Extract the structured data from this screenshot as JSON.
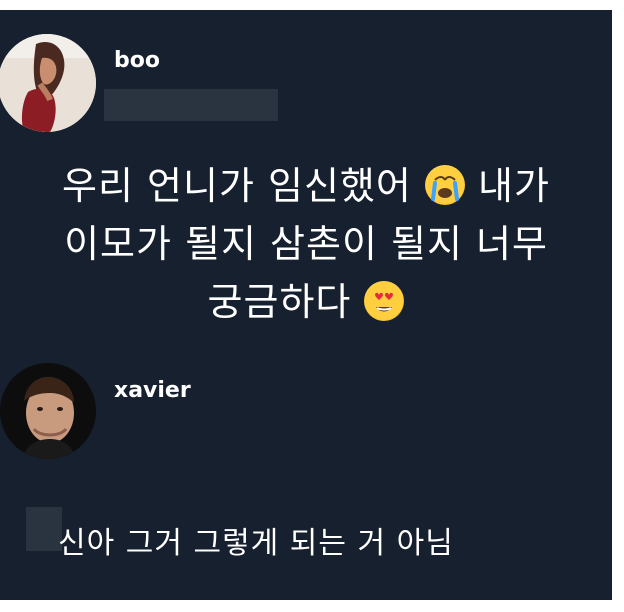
{
  "post": {
    "username": "boo",
    "text_lines": [
      "우리 언니가 임신했어",
      "내가",
      "이모가 될지 삼촌이 될지 너무",
      "궁금하다"
    ],
    "emoji_crying": "crying-emoji",
    "emoji_heart_eyes": "heart-eyes-emoji"
  },
  "reply": {
    "username": "xavier",
    "text": "신아 그거 그렇게 되는 거 아님"
  },
  "colors": {
    "background": "#17202e",
    "text": "#ffffff",
    "emoji_yellow": "#ffcc3a"
  }
}
